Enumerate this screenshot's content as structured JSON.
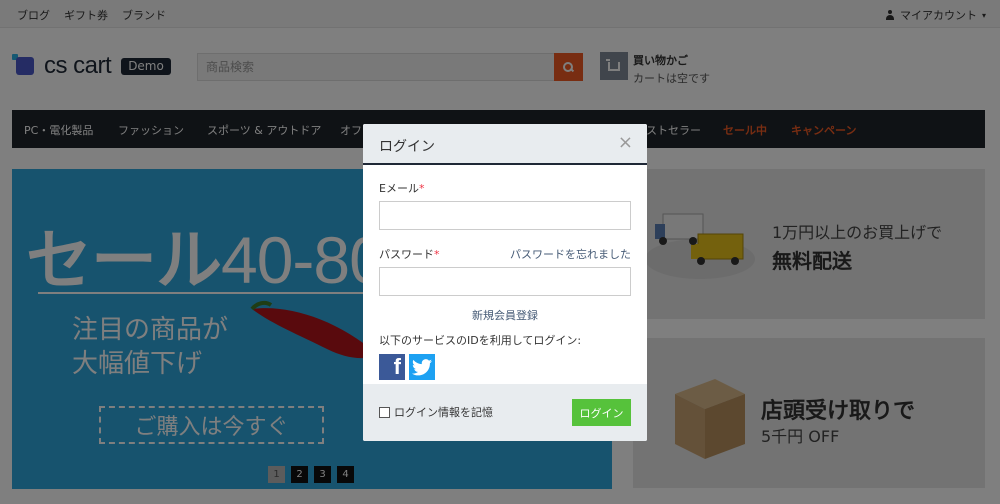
{
  "topbar": {
    "links": [
      "ブログ",
      "ギフト券",
      "ブランド"
    ],
    "account_label": "マイアカウント"
  },
  "header": {
    "logo_text": "cs cart",
    "demo_badge": "Demo",
    "search_placeholder": "商品検索",
    "cart_title": "買い物かご",
    "cart_status": "カートは空です"
  },
  "nav": {
    "items": [
      "PC・電化製品",
      "ファッション",
      "スポーツ & アウトドア",
      "オフ",
      "ストセラー",
      "セール中",
      "キャンペーン"
    ]
  },
  "hero": {
    "sale_word": "セール",
    "sale_pct": "40-80%",
    "line1": "注目の商品が",
    "line2": "大幅値下げ",
    "cta": "ご購入は今すぐ",
    "pages": [
      "1",
      "2",
      "3",
      "4"
    ]
  },
  "banners": {
    "b1_line1": "1万円以上のお買上げで",
    "b1_line2": "無料配送",
    "b2_line1": "店頭受け取りで",
    "b2_line2": "5千円 OFF"
  },
  "modal": {
    "title": "ログイン",
    "close": "×",
    "email_label": "Eメール",
    "required_mark": "*",
    "password_label": "パスワード",
    "forgot_link": "パスワードを忘れました",
    "register_link": "新規会員登録",
    "social_label": "以下のサービスのIDを利用してログイン:",
    "remember_label": "ログイン情報を記憶",
    "login_button": "ログイン"
  },
  "colors": {
    "accent": "#f15a24",
    "nav_bg": "#1f252b",
    "login_button": "#56c23b",
    "hero_bg": "#2fa7dd"
  },
  "icons": [
    "user-icon",
    "search-icon",
    "cart-icon",
    "close-icon",
    "facebook-icon",
    "twitter-icon"
  ]
}
